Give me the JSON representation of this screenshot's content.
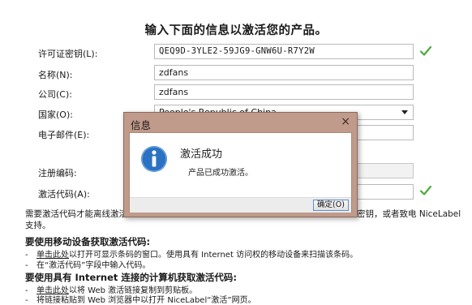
{
  "heading": "输入下面的信息以激活您的产品。",
  "form": {
    "license_key": {
      "label": "许可证密钥(L):",
      "value": "QEQ9D-3YLE2-59JG9-GNW6U-R7Y2W"
    },
    "name": {
      "label": "名称(N):",
      "value": "zdfans"
    },
    "company": {
      "label": "公司(C):",
      "value": "zdfans"
    },
    "country": {
      "label": "国家(O):",
      "value": "People's Republic of China"
    },
    "email": {
      "label": "电子邮件(E):",
      "value": ""
    },
    "registration_code": {
      "label": "注册编码:",
      "value": ""
    },
    "activation_code": {
      "label": "激活代码(A):",
      "value": ""
    }
  },
  "note_left": "需要激活代码才能离线激活。",
  "note_right": "密钥，或者致电 NiceLabel",
  "note_line2": "支持。",
  "mobile_section": {
    "title": "要使用移动设备获取激活代码:",
    "b1_link": "单击此处",
    "b1_text": "以打开可显示条码的窗口。使用具有 Internet 访问权的移动设备来扫描该条码。",
    "b2_text": "在“激活代码”字段中输入代码。"
  },
  "internet_section": {
    "title": "要使用具有 Internet 连接的计算机获取激活代码:",
    "b1_link": "单击此处",
    "b1_text": "以将 Web 激活链接复制到剪贴板。",
    "b2_text": "将链接粘贴到 Web 浏览器中以打开 NiceLabel“激活”网页。"
  },
  "dialog": {
    "title": "信息",
    "close_glyph": "×",
    "heading": "激活成功",
    "message": "产品已成功激活。",
    "ok_label": "确定(O)"
  },
  "icons": {
    "check": "check-icon",
    "info": "info-icon",
    "close": "close-icon"
  },
  "colors": {
    "check_green": "#4caa3c",
    "dialog_frame": "#c09a8a",
    "info_blue": "#2b72c2"
  }
}
